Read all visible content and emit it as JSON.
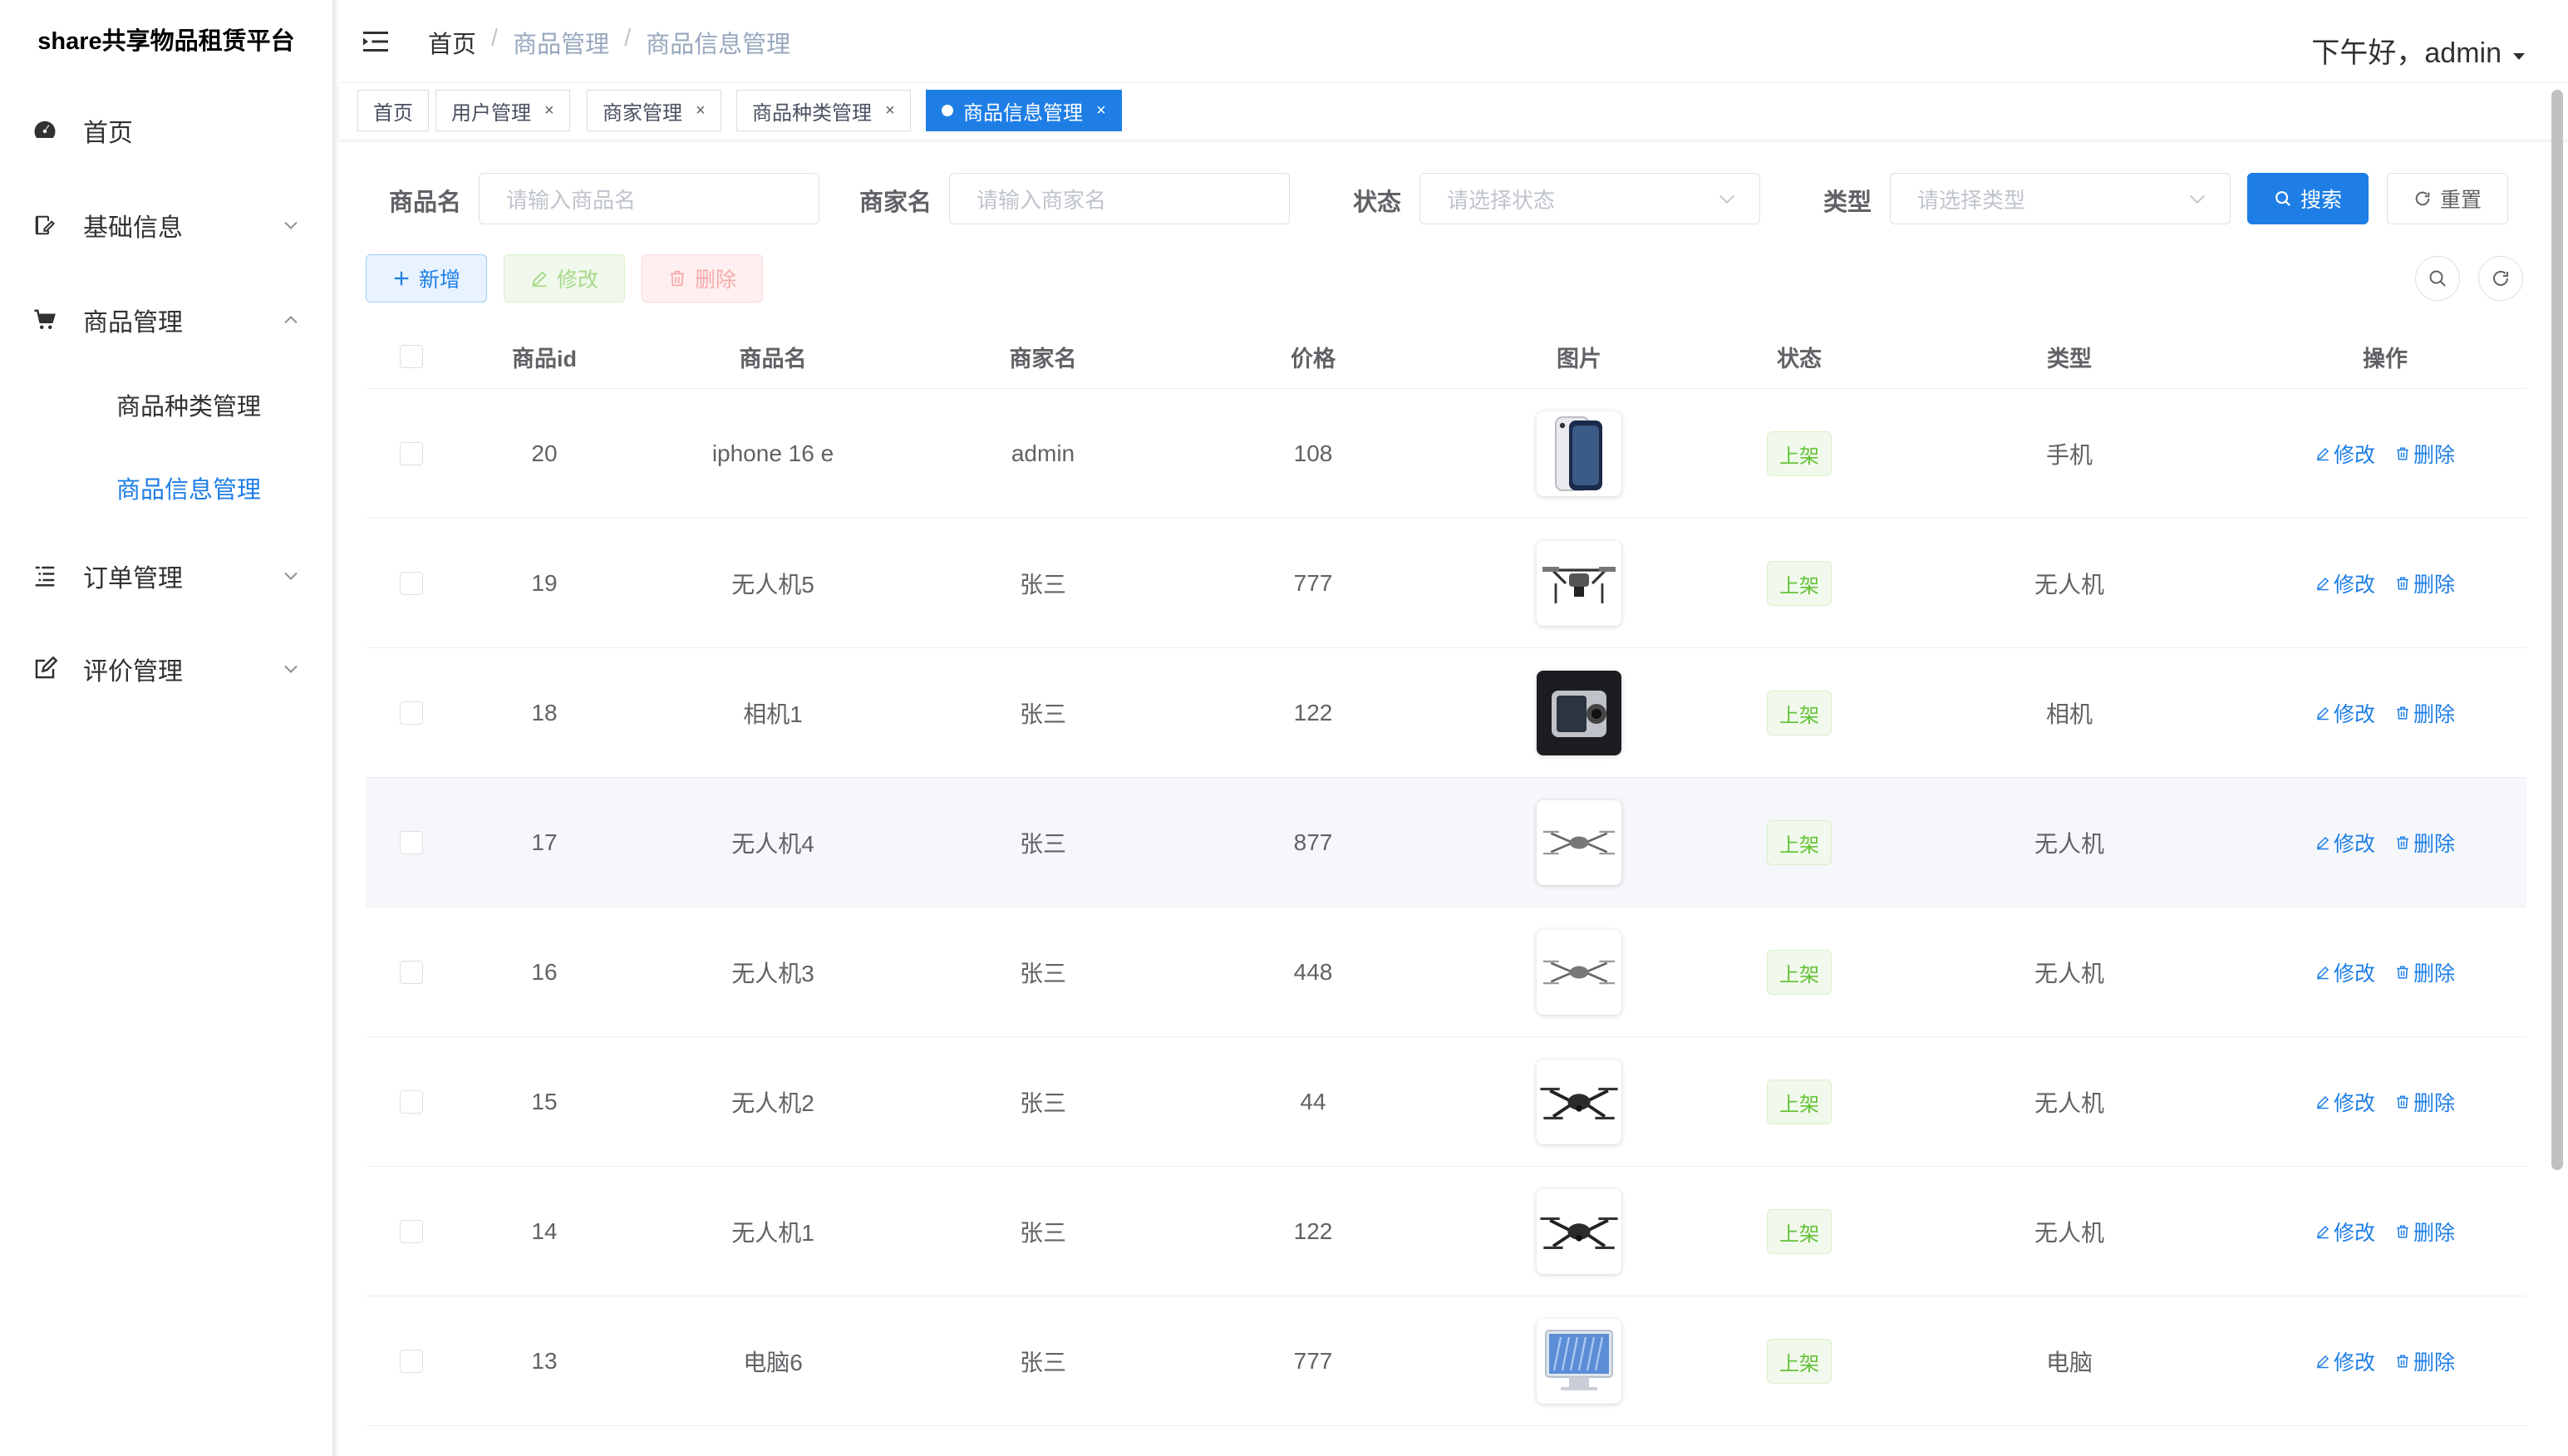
{
  "app": {
    "title": "share共享物品租赁平台"
  },
  "sidebar": {
    "items": [
      {
        "label": "首页",
        "icon": "dashboard-icon"
      },
      {
        "label": "基础信息",
        "icon": "edit-doc-icon"
      },
      {
        "label": "商品管理",
        "icon": "cart-icon"
      },
      {
        "label": "订单管理",
        "icon": "list-icon"
      },
      {
        "label": "评价管理",
        "icon": "edit-square-icon"
      }
    ],
    "submenu": [
      {
        "label": "商品种类管理"
      },
      {
        "label": "商品信息管理"
      }
    ]
  },
  "header": {
    "breadcrumb": [
      "首页",
      "商品管理",
      "商品信息管理"
    ],
    "separator": "/",
    "greeting": "下午好，admin"
  },
  "tags": [
    {
      "label": "首页"
    },
    {
      "label": "用户管理"
    },
    {
      "label": "商家管理"
    },
    {
      "label": "商品种类管理"
    },
    {
      "label": "商品信息管理"
    }
  ],
  "tag_close": "×",
  "search": {
    "name_label": "商品名",
    "name_placeholder": "请输入商品名",
    "merchant_label": "商家名",
    "merchant_placeholder": "请输入商家名",
    "status_label": "状态",
    "status_placeholder": "请选择状态",
    "type_label": "类型",
    "type_placeholder": "请选择类型",
    "search_btn": "搜索",
    "reset_btn": "重置"
  },
  "toolbar": {
    "add": "新增",
    "edit": "修改",
    "delete": "删除"
  },
  "table": {
    "headers": [
      "商品id",
      "商品名",
      "商家名",
      "价格",
      "图片",
      "状态",
      "类型",
      "操作"
    ],
    "rows": [
      {
        "id": "20",
        "name": "iphone 16 e",
        "merchant": "admin",
        "price": "108",
        "img": "phone",
        "status": "上架",
        "type": "手机"
      },
      {
        "id": "19",
        "name": "无人机5",
        "merchant": "张三",
        "price": "777",
        "img": "drone-large",
        "status": "上架",
        "type": "无人机"
      },
      {
        "id": "18",
        "name": "相机1",
        "merchant": "张三",
        "price": "122",
        "img": "camera",
        "status": "上架",
        "type": "相机"
      },
      {
        "id": "17",
        "name": "无人机4",
        "merchant": "张三",
        "price": "877",
        "img": "drone-small",
        "status": "上架",
        "type": "无人机"
      },
      {
        "id": "16",
        "name": "无人机3",
        "merchant": "张三",
        "price": "448",
        "img": "drone-small",
        "status": "上架",
        "type": "无人机"
      },
      {
        "id": "15",
        "name": "无人机2",
        "merchant": "张三",
        "price": "44",
        "img": "drone-dark",
        "status": "上架",
        "type": "无人机"
      },
      {
        "id": "14",
        "name": "无人机1",
        "merchant": "张三",
        "price": "122",
        "img": "drone-dark",
        "status": "上架",
        "type": "无人机"
      },
      {
        "id": "13",
        "name": "电脑6",
        "merchant": "张三",
        "price": "777",
        "img": "monitor",
        "status": "上架",
        "type": "电脑"
      }
    ],
    "op_edit": "修改",
    "op_delete": "删除"
  },
  "colors": {
    "primary": "#1e7ee6",
    "success": "#67c23a",
    "danger": "#f56c6c"
  }
}
